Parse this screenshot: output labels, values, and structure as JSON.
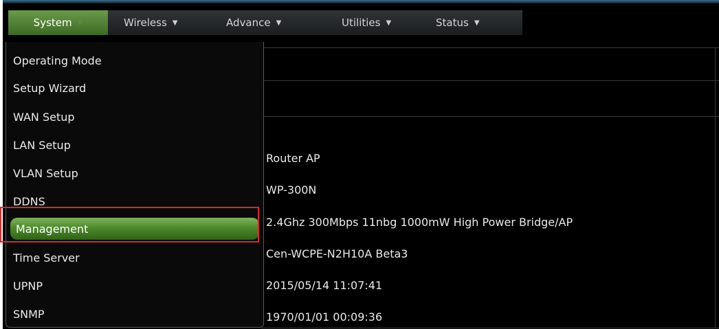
{
  "menubar": {
    "items": [
      {
        "label": "System",
        "active": true
      },
      {
        "label": "Wireless",
        "active": false
      },
      {
        "label": "Advance",
        "active": false
      },
      {
        "label": "Utilities",
        "active": false
      },
      {
        "label": "Status",
        "active": false
      }
    ]
  },
  "dropdown": {
    "items": [
      {
        "label": "Operating Mode"
      },
      {
        "label": "Setup Wizard"
      },
      {
        "label": "WAN Setup"
      },
      {
        "label": "LAN Setup"
      },
      {
        "label": "VLAN Setup"
      },
      {
        "label": "DDNS"
      },
      {
        "label": "Management",
        "highlighted": true
      },
      {
        "label": "Time Server"
      },
      {
        "label": "UPNP"
      },
      {
        "label": "SNMP"
      }
    ]
  },
  "info_values": [
    "Router AP",
    "WP-300N",
    "2.4Ghz 300Mbps 11nbg 1000mW High Power Bridge/AP",
    "Cen-WCPE-N2H10A Beta3",
    "2015/05/14 11:07:41",
    "1970/01/01 00:09:36"
  ],
  "colors": {
    "active_menu": "#5d8a3f",
    "highlight": "#4e8a2c",
    "annotation": "#d92a2a"
  }
}
